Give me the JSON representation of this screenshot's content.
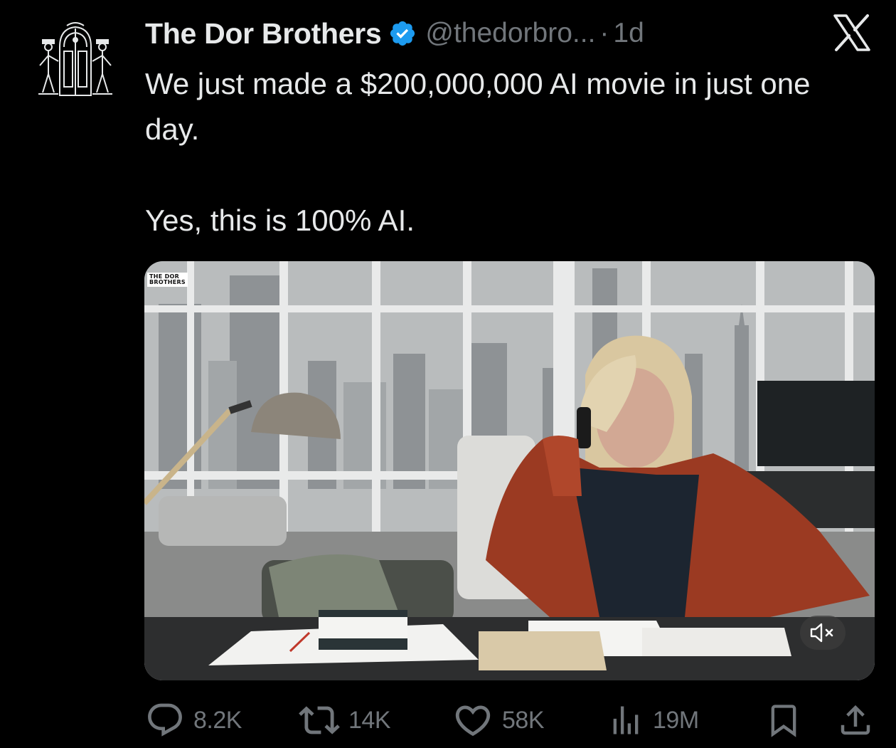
{
  "author": {
    "display_name": "The Dor Brothers",
    "handle": "@thedorbro...",
    "separator": "·",
    "time": "1d",
    "verified_color": "#1d9bf0"
  },
  "tweet": {
    "line1": "We just made a $200,000,000 AI movie in just one day.",
    "line2": "Yes, this is 100% AI."
  },
  "media": {
    "watermark": "THE DOR\nBROTHERS",
    "mute_icon": "speaker-muted-icon"
  },
  "actions": {
    "replies": "8.2K",
    "reposts": "14K",
    "likes": "58K",
    "views": "19M"
  },
  "icons": {
    "platform": "x-logo-icon",
    "reply": "reply-icon",
    "repost": "repost-icon",
    "like": "heart-icon",
    "views": "views-icon",
    "bookmark": "bookmark-icon",
    "share": "share-icon"
  }
}
